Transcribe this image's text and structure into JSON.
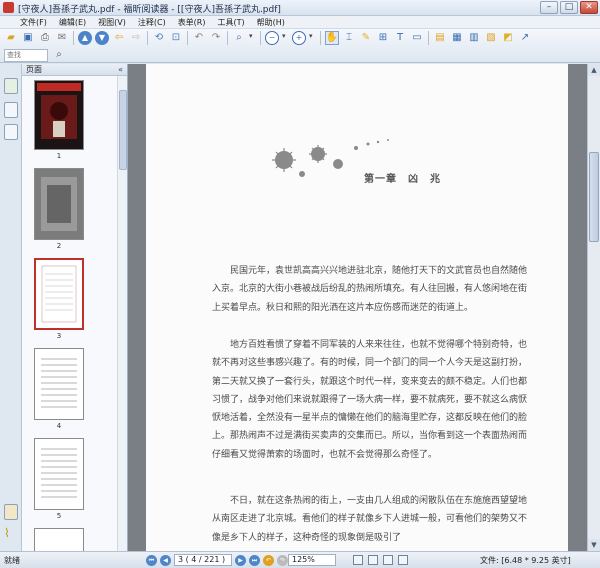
{
  "window": {
    "title": "[守夜人]吾孫子武丸.pdf - 福昕阅读器 - [[守夜人]吾孫子武丸.pdf]",
    "min": "–",
    "max": "□",
    "close": "✕"
  },
  "menu": [
    "文件(F)",
    "编辑(E)",
    "视图(V)",
    "注释(C)",
    "表单(R)",
    "工具(T)",
    "帮助(H)"
  ],
  "toolbar": {
    "search_placeholder": "查找"
  },
  "thumbnails": {
    "title": "页面",
    "collapse": "«",
    "pages": [
      "1",
      "2",
      "3",
      "4",
      "5"
    ]
  },
  "document": {
    "chapter": "第一章　凶　兆",
    "paragraphs": [
      "民国元年，袁世凯高高兴兴地进驻北京，随他打天下的文武官员也自然随他入京。北京的大街小巷被战后纷乱的热闹所填充。有人往回搬，有人悠闲地在街上买着早点。秋日和熙的阳光洒在这片本应伤感而迷茫的街道上。",
      "地方百姓看惯了穿着不同军装的人来来往往，也就不觉得哪个特别奇特，也就不再对这些事感兴趣了。有的时候，同一个部门的同一个人今天是这副打扮，第二天就又换了一套行头，就跟这个时代一样，变来变去的颇不稳定。人们也都习惯了，战争对他们来说就跟得了一场大病一样，要不就病死，要不就这么病恹恹地活着，全然没有一星半点的慵懒在他们的脑海里贮存，这都反映在他们的脸上。那热闹声不过是满街买卖声的交集而已。所以，当你看到这一个表面热闹而仔细看又觉得萧索的场面时，也就不会觉得那么奇怪了。",
      "不日，就在这条热闹的街上，一支由几人组成的闲散队伍在东施施西望望地从南区走进了北京城。看他们的样子就像乡下人进城一般，可看他们的架势又不像是乡下人的样子，这种奇怪的现象倒是吸引了"
    ]
  },
  "status": {
    "ready": "就绪",
    "page": "3 ( 4 / 221 )",
    "zoom": "125%",
    "filesize": "文件: [6.48 * 9.25 英寸]"
  }
}
